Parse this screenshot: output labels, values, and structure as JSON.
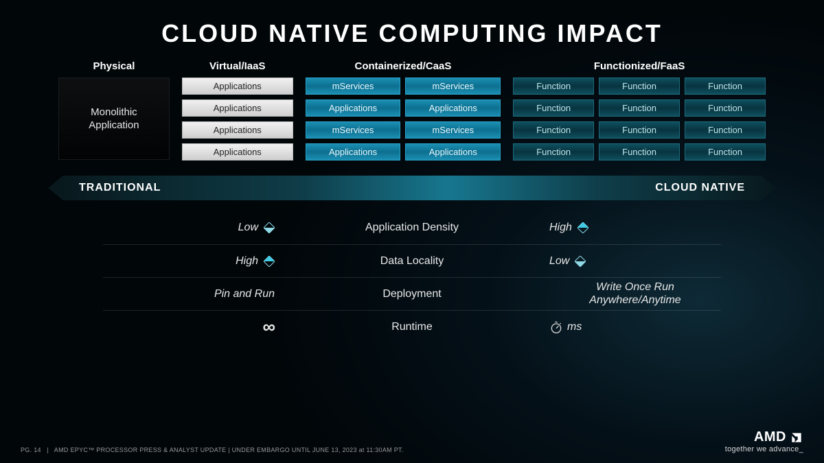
{
  "title": "CLOUD NATIVE COMPUTING IMPACT",
  "columns": {
    "physical": {
      "header": "Physical",
      "block": "Monolithic\nApplication"
    },
    "virtual": {
      "header": "Virtual/IaaS",
      "rows": [
        "Applications",
        "Applications",
        "Applications",
        "Applications"
      ]
    },
    "caas": {
      "header": "Containerized/CaaS",
      "rows": [
        [
          "mServices",
          "mServices"
        ],
        [
          "Applications",
          "Applications"
        ],
        [
          "mServices",
          "mServices"
        ],
        [
          "Applications",
          "Applications"
        ]
      ]
    },
    "faas": {
      "header": "Functionized/FaaS",
      "rows": [
        [
          "Function",
          "Function",
          "Function"
        ],
        [
          "Function",
          "Function",
          "Function"
        ],
        [
          "Function",
          "Function",
          "Function"
        ],
        [
          "Function",
          "Function",
          "Function"
        ]
      ]
    }
  },
  "arrow": {
    "left": "TRADITIONAL",
    "right": "CLOUD NATIVE"
  },
  "metrics": [
    {
      "left": "Low",
      "leftIcon": "diamond-down",
      "center": "Application Density",
      "right": "High",
      "rightIcon": "diamond-up"
    },
    {
      "left": "High",
      "leftIcon": "diamond-up",
      "center": "Data Locality",
      "right": "Low",
      "rightIcon": "diamond-down"
    },
    {
      "left": "Pin and Run",
      "leftIcon": "",
      "center": "Deployment",
      "right": "Write Once Run Anywhere/Anytime",
      "rightIcon": ""
    },
    {
      "left": "∞",
      "leftIcon": "infinity",
      "center": "Runtime",
      "right": "ms",
      "rightIcon": "stopwatch"
    }
  ],
  "footer": {
    "page": "PG. 14",
    "note": "AMD EPYC™ PROCESSOR PRESS & ANALYST UPDATE | UNDER EMBARGO UNTIL JUNE 13, 2023 at 11:30AM PT.",
    "brand": "AMD",
    "tagline": "together we advance_"
  }
}
